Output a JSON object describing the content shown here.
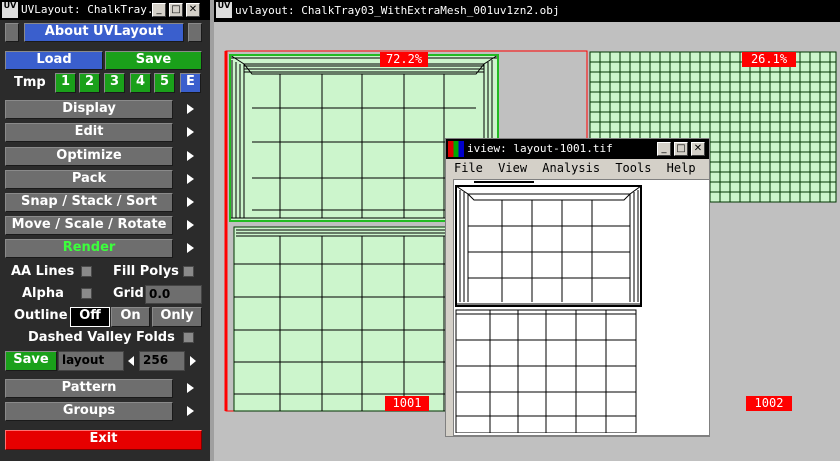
{
  "panel": {
    "title": "UVLayout: ChalkTray...",
    "about": "About UVLayout",
    "load": "Load",
    "save": "Save",
    "tmp_label": "Tmp",
    "tmp_slots": [
      "1",
      "2",
      "3",
      "4",
      "5",
      "E"
    ],
    "menus": [
      "Display",
      "Edit",
      "Optimize",
      "Pack",
      "Snap / Stack / Sort",
      "Move / Scale / Rotate",
      "Render"
    ],
    "aa_lines": "AA Lines",
    "fill_polys": "Fill Polys",
    "alpha": "Alpha",
    "grid": "Grid",
    "grid_value": "0.0",
    "outline": "Outline",
    "outline_options": [
      "Off",
      "On",
      "Only"
    ],
    "outline_selected": "Off",
    "dashed_valley_folds": "Dashed Valley Folds",
    "save2": "Save",
    "layout_name": "layout",
    "resolution": "256",
    "pattern": "Pattern",
    "groups": "Groups",
    "exit": "Exit",
    "colors": {
      "blue": "#3a5fcd",
      "green": "#1aa01a",
      "red": "#e60000",
      "render_text": "#3cff3c"
    }
  },
  "viewport": {
    "title": "uvlayout: ChalkTray03_WithExtraMesh_001uv1zn2.obj",
    "tile1_pct": "72.2%",
    "tile2_pct": "26.1%",
    "tile1_label": "1001",
    "tile2_label": "1002",
    "colors": {
      "mesh_fill": "#ccf5cc",
      "edge": "#006600",
      "tag": "#ff0000"
    }
  },
  "iview": {
    "title": "iview: layout-1001.tif",
    "menu": [
      "File",
      "View",
      "Analysis",
      "Tools",
      "Help"
    ]
  }
}
